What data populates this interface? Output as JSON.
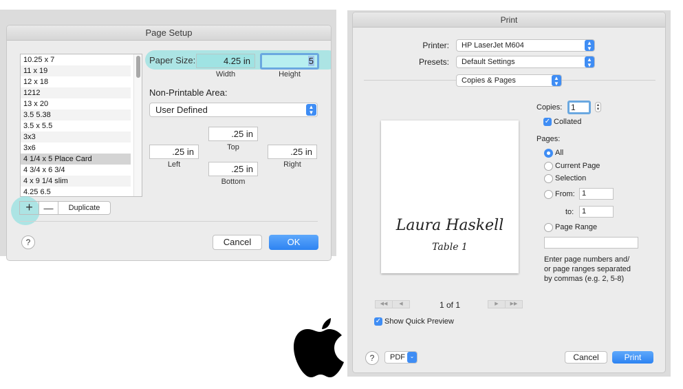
{
  "page_setup": {
    "title": "Page Setup",
    "paper_sizes": [
      "10.25 x 7",
      "11 x 19",
      "12 x 18",
      "1212",
      "13 x 20",
      "3.5 5.38",
      "3.5 x 5.5",
      "3x3",
      "3x6",
      "4 1/4 x 5 Place Card",
      "4 3/4 x 6 3/4",
      "4 x 9 1/4 slim",
      "4.25 6.5"
    ],
    "selected_paper_size": "4 1/4 x 5 Place Card",
    "add_label": "+",
    "remove_label": "—",
    "duplicate_label": "Duplicate",
    "paper_size_label": "Paper Size:",
    "width_value": "4.25 in",
    "height_value": "5",
    "width_caption": "Width",
    "height_caption": "Height",
    "non_printable_label": "Non-Printable Area:",
    "printer_select": "User Defined",
    "margins": {
      "top_value": ".25 in",
      "top_caption": "Top",
      "left_value": ".25 in",
      "left_caption": "Left",
      "right_value": ".25 in",
      "right_caption": "Right",
      "bottom_value": ".25 in",
      "bottom_caption": "Bottom"
    },
    "help_label": "?",
    "cancel_label": "Cancel",
    "ok_label": "OK"
  },
  "print": {
    "title": "Print",
    "printer_label": "Printer:",
    "printer_value": "HP LaserJet M604",
    "presets_label": "Presets:",
    "presets_value": "Default Settings",
    "section_value": "Copies & Pages",
    "preview_name": "Laura Haskell",
    "preview_table": "Table 1",
    "page_counter": "1 of 1",
    "show_quick_preview": "Show Quick Preview",
    "copies_label": "Copies:",
    "copies_value": "1",
    "collated_label": "Collated",
    "pages_label": "Pages:",
    "all_label": "All",
    "current_page_label": "Current Page",
    "selection_label": "Selection",
    "from_label": "From:",
    "from_value": "1",
    "to_label": "to:",
    "to_value": "1",
    "page_range_label": "Page Range",
    "hint_line1": "Enter page numbers and/",
    "hint_line2": "or page ranges separated",
    "hint_line3": "by commas (e.g. 2, 5-8)",
    "help_label": "?",
    "pdf_label": "PDF",
    "cancel_label": "Cancel",
    "print_label": "Print"
  },
  "icons": {
    "stepper": "up-down-chevron-icon",
    "checkbox": "checkmark-icon",
    "logo": "apple-logo-icon"
  },
  "colors": {
    "accent": "#3f8df4",
    "highlight": "#78dede"
  }
}
